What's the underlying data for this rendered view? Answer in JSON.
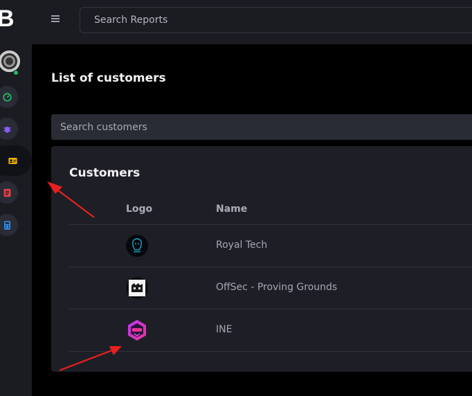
{
  "app": {
    "brand_letter": "B"
  },
  "topbar": {
    "search_placeholder": "Search Reports"
  },
  "sidebar": {
    "items": [
      {
        "icon": "speedometer-icon",
        "color": "#25c26e"
      },
      {
        "icon": "bug-icon",
        "color": "#8a5cf6"
      },
      {
        "icon": "id-card-icon",
        "color": "#f5b400",
        "active": true
      },
      {
        "icon": "document-icon",
        "color": "#e8414f"
      },
      {
        "icon": "calculator-icon",
        "color": "#2f8ff0"
      }
    ]
  },
  "page": {
    "title": "List of customers",
    "search_placeholder": "Search customers"
  },
  "customers": {
    "title": "Customers",
    "columns": [
      "Logo",
      "Name"
    ],
    "rows": [
      {
        "name": "Royal Tech",
        "logo": "royal-tech-logo"
      },
      {
        "name": "OffSec - Proving Grounds",
        "logo": "offsec-logo"
      },
      {
        "name": "INE",
        "logo": "ine-logo"
      }
    ]
  },
  "colors": {
    "background": "#000000",
    "panel": "#1b1c22",
    "card": "#1e1f26",
    "input": "#2a2c35",
    "annotation_arrow": "#e8201f"
  }
}
